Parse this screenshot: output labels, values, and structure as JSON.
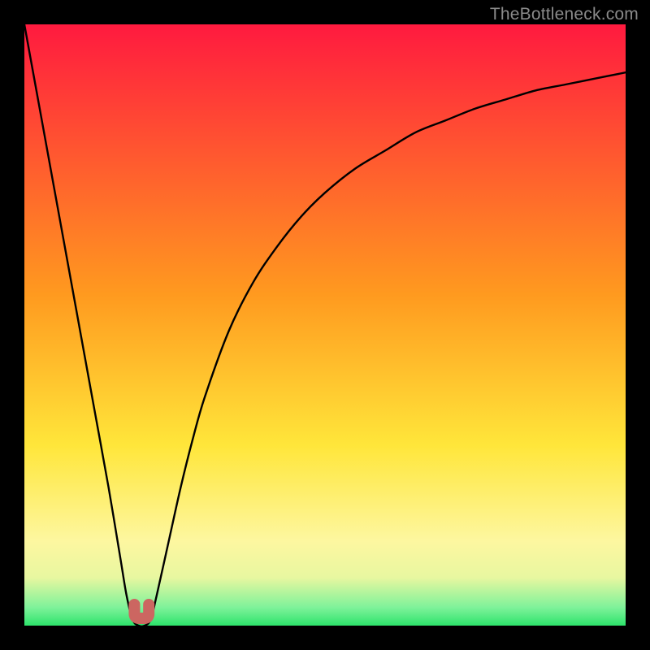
{
  "watermark": "TheBottleneck.com",
  "accent_marker_color": "#cc6661",
  "chart_data": {
    "type": "line",
    "title": "",
    "xlabel": "",
    "ylabel": "",
    "xlim": [
      0,
      100
    ],
    "ylim": [
      0,
      100
    ],
    "grid": false,
    "legend": false,
    "annotations": [],
    "gradient_stops": [
      {
        "offset": 0,
        "color": "#ff1a3f"
      },
      {
        "offset": 45,
        "color": "#ff9a1f"
      },
      {
        "offset": 70,
        "color": "#ffe63a"
      },
      {
        "offset": 86,
        "color": "#fdf7a0"
      },
      {
        "offset": 92,
        "color": "#e8f7a0"
      },
      {
        "offset": 97,
        "color": "#7ef29a"
      },
      {
        "offset": 100,
        "color": "#2de36b"
      }
    ],
    "series": [
      {
        "name": "bottleneck-curve",
        "x": [
          0,
          2,
          4,
          6,
          8,
          10,
          12,
          14,
          16,
          17,
          18,
          19,
          20,
          21,
          22,
          24,
          26,
          28,
          30,
          34,
          38,
          42,
          46,
          50,
          55,
          60,
          65,
          70,
          75,
          80,
          85,
          90,
          95,
          100
        ],
        "y": [
          100,
          89,
          78,
          67,
          56,
          45,
          34,
          23,
          11,
          5,
          1,
          0,
          0,
          1,
          5,
          14,
          23,
          31,
          38,
          49,
          57,
          63,
          68,
          72,
          76,
          79,
          82,
          84,
          86,
          87.5,
          89,
          90,
          91,
          92
        ]
      }
    ],
    "marker": {
      "x_range": [
        18.3,
        20.7
      ],
      "y": 0,
      "width_pct": 2.4
    }
  }
}
